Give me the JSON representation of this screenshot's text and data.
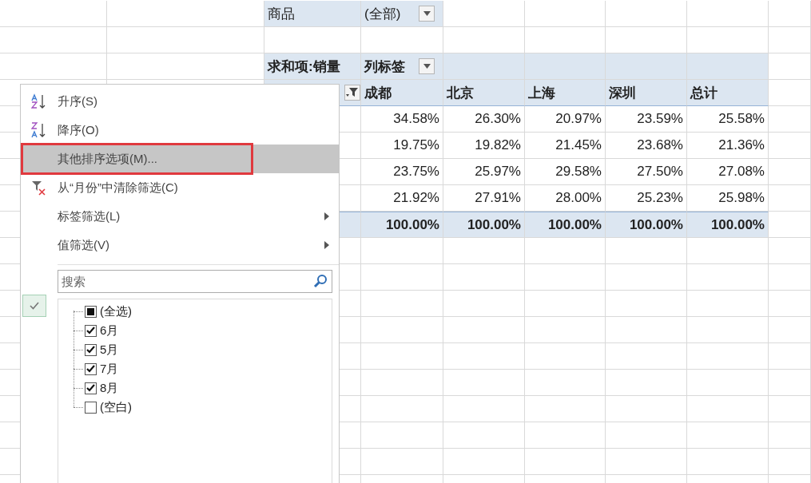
{
  "pivot": {
    "filter_field": "商品",
    "filter_value": "(全部)",
    "value_field": "求和项:销量",
    "column_label": "列标签",
    "columns": [
      "成都",
      "北京",
      "上海",
      "深圳",
      "总计"
    ],
    "rows": [
      [
        "34.58%",
        "26.30%",
        "20.97%",
        "23.59%",
        "25.58%"
      ],
      [
        "19.75%",
        "19.82%",
        "21.45%",
        "23.68%",
        "21.36%"
      ],
      [
        "23.75%",
        "25.97%",
        "29.58%",
        "27.50%",
        "27.08%"
      ],
      [
        "21.92%",
        "27.91%",
        "28.00%",
        "25.23%",
        "25.98%"
      ]
    ],
    "total": [
      "100.00%",
      "100.00%",
      "100.00%",
      "100.00%",
      "100.00%"
    ]
  },
  "filter_menu": {
    "items": [
      {
        "kind": "sort-asc",
        "label": "升序(S)",
        "selected": false,
        "marked": false,
        "submenu": false
      },
      {
        "kind": "sort-desc",
        "label": "降序(O)",
        "selected": false,
        "marked": false,
        "submenu": false
      },
      {
        "kind": "plain",
        "label": "其他排序选项(M)...",
        "selected": true,
        "marked": true,
        "submenu": false
      },
      {
        "kind": "clear-filter",
        "label": "从“月份”中清除筛选(C)",
        "selected": false,
        "marked": false,
        "submenu": false
      },
      {
        "kind": "plain",
        "label": "标签筛选(L)",
        "selected": false,
        "marked": false,
        "submenu": true
      },
      {
        "kind": "plain",
        "label": "值筛选(V)",
        "selected": false,
        "marked": false,
        "submenu": true
      }
    ],
    "search": {
      "placeholder": "搜索"
    },
    "checklist": [
      {
        "label": "(全选)",
        "checked": false,
        "partial": true
      },
      {
        "label": "6月",
        "checked": true,
        "partial": false
      },
      {
        "label": "5月",
        "checked": true,
        "partial": false
      },
      {
        "label": "7月",
        "checked": true,
        "partial": false
      },
      {
        "label": "8月",
        "checked": true,
        "partial": false
      },
      {
        "label": "(空白)",
        "checked": false,
        "partial": false
      }
    ]
  }
}
